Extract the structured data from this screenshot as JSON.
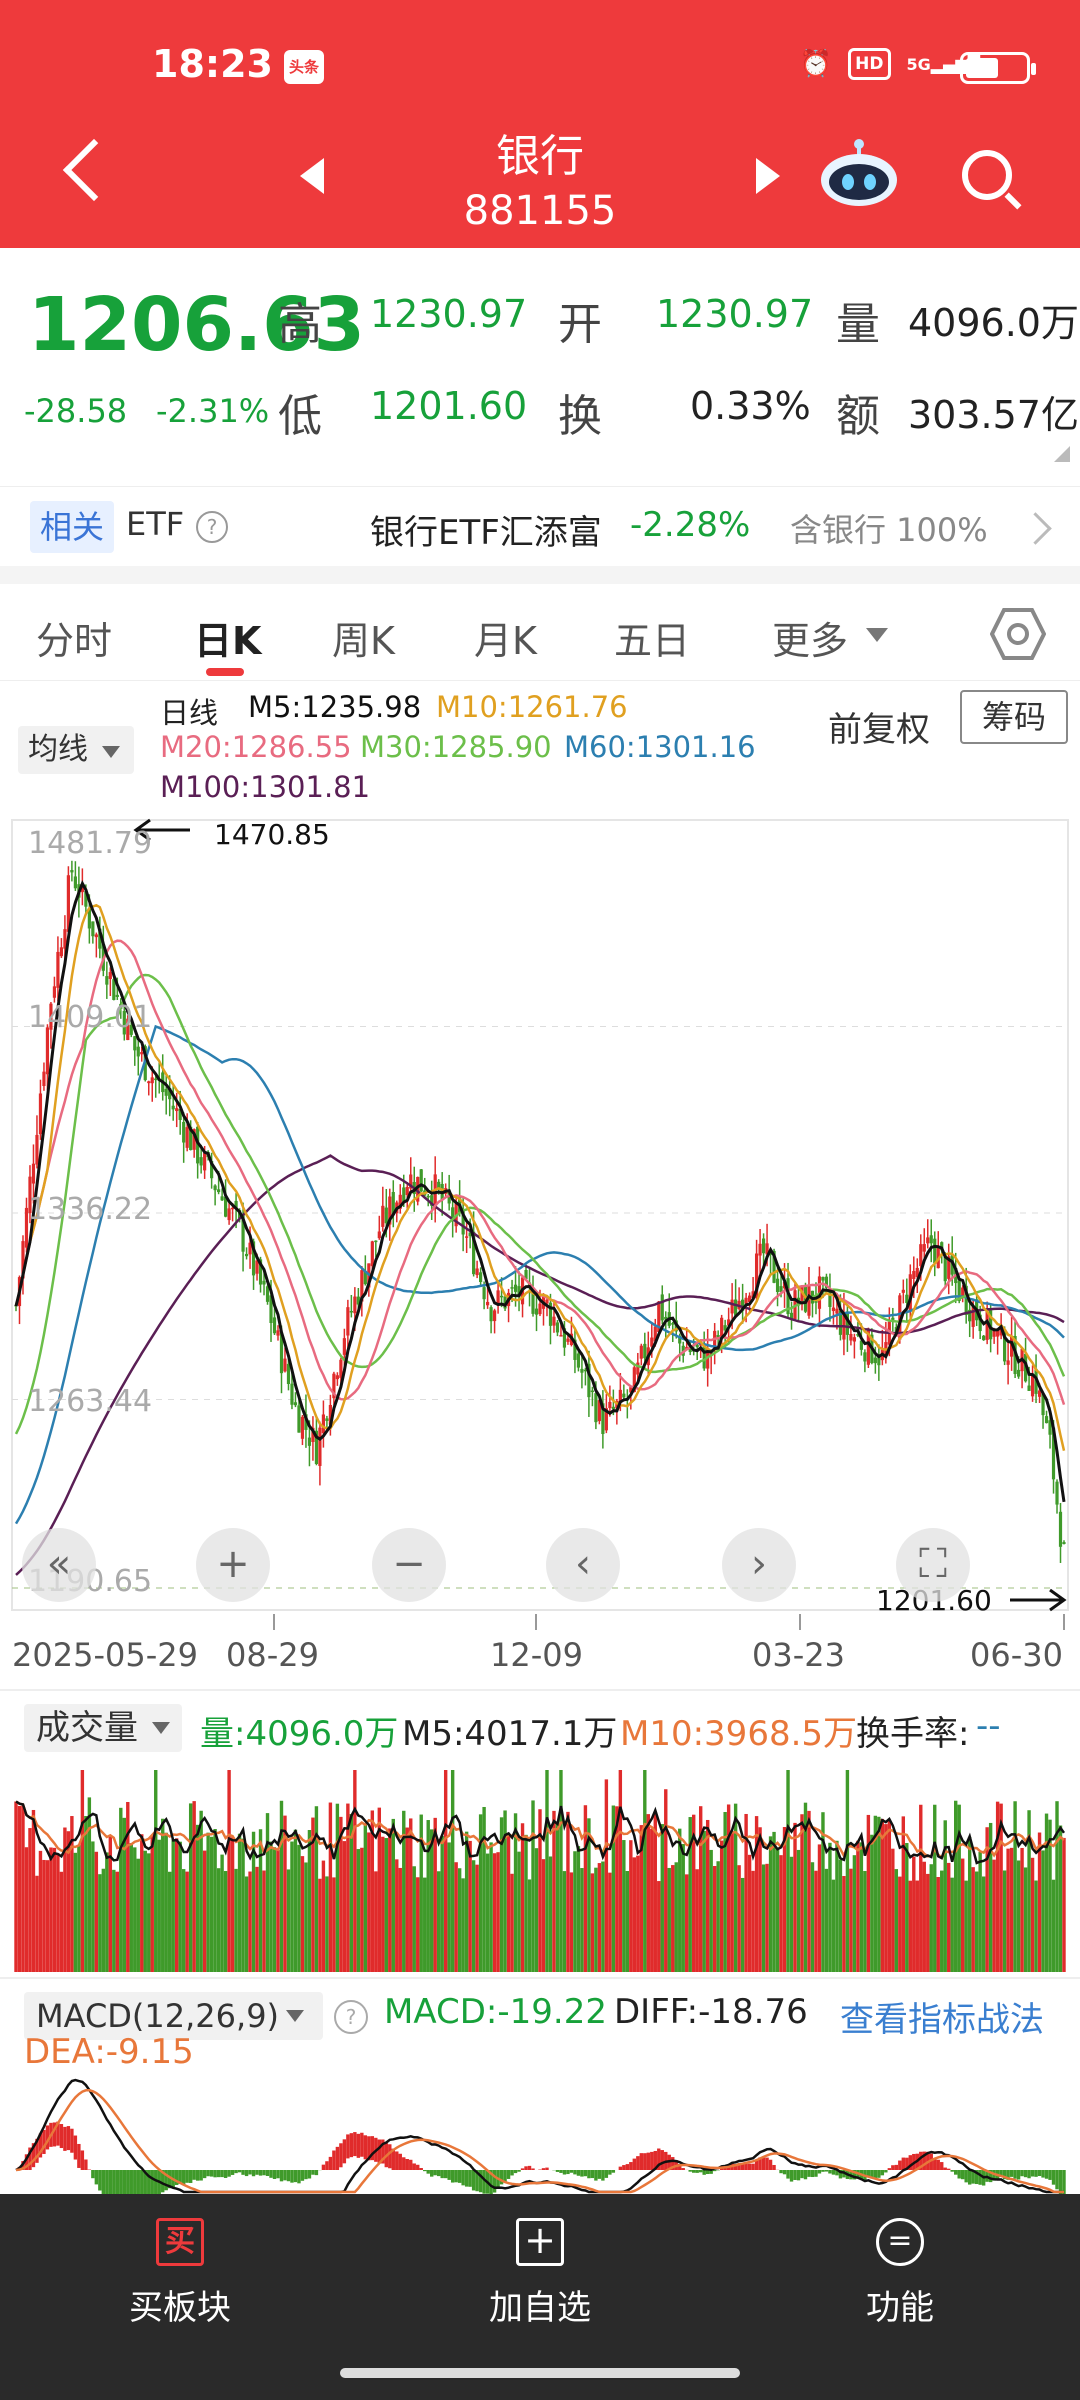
{
  "status_bar": {
    "time": "18:23",
    "app_badge": "头条",
    "hd": "HD",
    "net": "5G",
    "battery_level": 0.55
  },
  "header": {
    "title": "银行",
    "code": "881155"
  },
  "quote": {
    "price": "1206.63",
    "change": "-28.58",
    "change_pct": "-2.31%",
    "high_label": "高",
    "high": "1230.97",
    "low_label": "低",
    "low": "1201.60",
    "open_label": "开",
    "open": "1230.97",
    "turnover_label": "换",
    "turnover": "0.33%",
    "volume_label": "量",
    "volume": "4096.0万",
    "amount_label": "额",
    "amount": "303.57亿"
  },
  "etf": {
    "tag": "相关",
    "label": "ETF",
    "name": "银行ETF汇添富",
    "pct": "-2.28%",
    "holding": "含银行 100%"
  },
  "tabs": [
    "分时",
    "日K",
    "周K",
    "月K",
    "五日",
    "更多"
  ],
  "active_tab": "日K",
  "ma_legend": {
    "selector": "均线",
    "period": "日线",
    "m5": "M5:1235.98",
    "m10": "M10:1261.76",
    "m20": "M20:1286.55",
    "m30": "M30:1285.90",
    "m60": "M60:1301.16",
    "m100": "M100:1301.81",
    "adjust": "前复权",
    "chips": "筹码"
  },
  "colors": {
    "m5": "#111111",
    "m10": "#e0a020",
    "m20": "#e86b80",
    "m30": "#6cbf4a",
    "m60": "#2c7fb0",
    "m100": "#5a1f55",
    "up": "#e02b2b",
    "down": "#3f9a2a",
    "header": "#ee3a3c"
  },
  "chart_data": [
    {
      "type": "candlestick",
      "y_ticks": [
        "1481.79",
        "1409.01",
        "1336.22",
        "1263.44",
        "1190.65"
      ],
      "ylim": [
        1190.65,
        1481.79
      ],
      "x_ticks": [
        "2025-05-29",
        "08-29",
        "12-09",
        "03-23",
        "06-30"
      ],
      "max_marker": "1470.85",
      "min_marker": "1201.60",
      "ma_close_path": [
        [
          0,
          1300
        ],
        [
          10,
          1420
        ],
        [
          16,
          1470
        ],
        [
          24,
          1440
        ],
        [
          34,
          1400
        ],
        [
          44,
          1380
        ],
        [
          56,
          1350
        ],
        [
          64,
          1330
        ],
        [
          72,
          1300
        ],
        [
          80,
          1260
        ],
        [
          86,
          1245
        ],
        [
          94,
          1290
        ],
        [
          104,
          1330
        ],
        [
          112,
          1350
        ],
        [
          120,
          1345
        ],
        [
          128,
          1330
        ],
        [
          136,
          1300
        ],
        [
          144,
          1305
        ],
        [
          152,
          1300
        ],
        [
          160,
          1280
        ],
        [
          168,
          1255
        ],
        [
          176,
          1265
        ],
        [
          184,
          1300
        ],
        [
          190,
          1285
        ],
        [
          198,
          1280
        ],
        [
          206,
          1300
        ],
        [
          214,
          1320
        ],
        [
          222,
          1300
        ],
        [
          230,
          1305
        ],
        [
          238,
          1290
        ],
        [
          248,
          1280
        ],
        [
          256,
          1310
        ],
        [
          262,
          1325
        ],
        [
          268,
          1310
        ],
        [
          276,
          1295
        ],
        [
          286,
          1280
        ],
        [
          292,
          1270
        ],
        [
          296,
          1245
        ],
        [
          300,
          1202
        ]
      ]
    },
    {
      "type": "bar",
      "title": "成交量",
      "series": [
        {
          "name": "量:4096.0万"
        },
        {
          "name": "M5:4017.1万"
        },
        {
          "name": "M10:3968.5万"
        }
      ]
    },
    {
      "type": "bar",
      "title": "MACD(12,26,9)",
      "series": [
        {
          "name": "MACD:-19.22"
        },
        {
          "name": "DIFF:-18.76"
        },
        {
          "name": "DEA:-9.15"
        }
      ]
    }
  ],
  "volume_panel": {
    "selector": "成交量",
    "vol": "量:4096.0万",
    "m5": "M5:4017.1万",
    "m10": "M10:3968.5万",
    "turnover": "换手率:",
    "turnover_val": "--"
  },
  "macd_panel": {
    "selector": "MACD(12,26,9)",
    "macd": "MACD:-19.22",
    "diff": "DIFF:-18.76",
    "dea": "DEA:-9.15",
    "link": "查看指标战法"
  },
  "bottom_bar": [
    {
      "icon": "buy-icon",
      "glyph": "买",
      "label": "买板块"
    },
    {
      "icon": "add-watch-icon",
      "glyph": "+",
      "label": "加自选"
    },
    {
      "icon": "function-icon",
      "glyph": "=",
      "label": "功能"
    }
  ]
}
